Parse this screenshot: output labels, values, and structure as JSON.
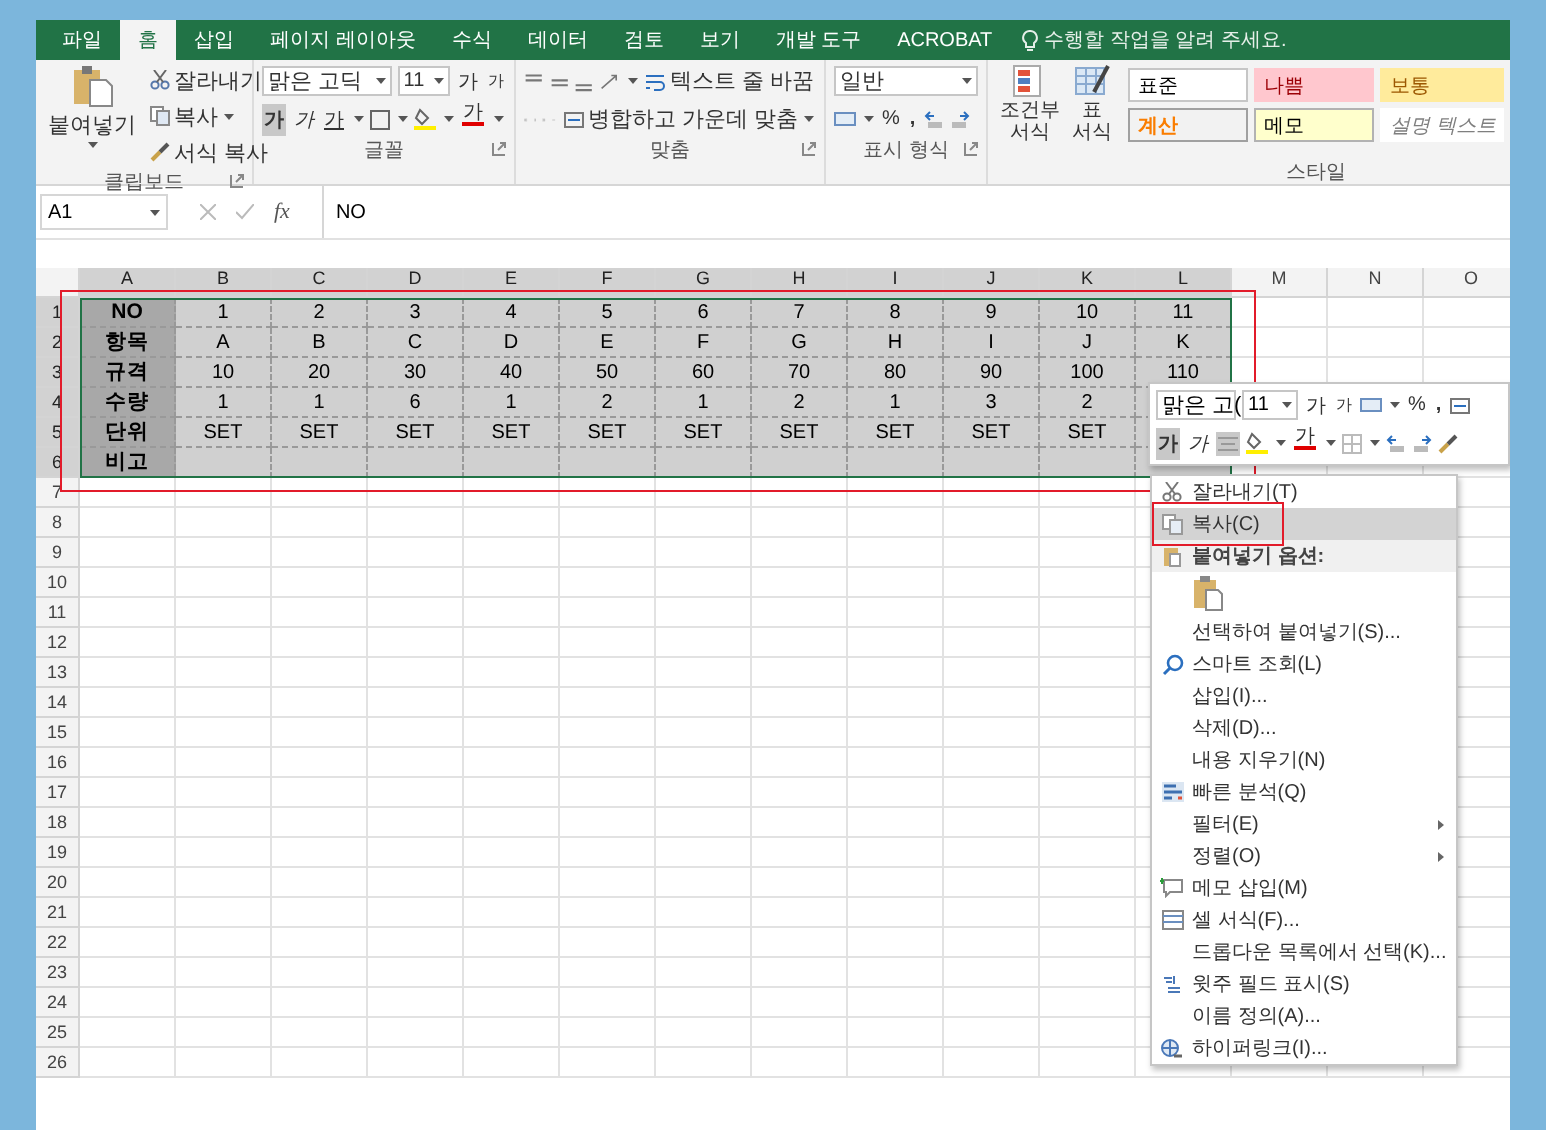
{
  "tabs": [
    {
      "label": "파일",
      "selected": false
    },
    {
      "label": "홈",
      "selected": true
    },
    {
      "label": "삽입",
      "selected": false
    },
    {
      "label": "페이지 레이아웃",
      "selected": false
    },
    {
      "label": "수식",
      "selected": false
    },
    {
      "label": "데이터",
      "selected": false
    },
    {
      "label": "검토",
      "selected": false
    },
    {
      "label": "보기",
      "selected": false
    },
    {
      "label": "개발 도구",
      "selected": false
    },
    {
      "label": "ACROBAT",
      "selected": false
    }
  ],
  "tell_me": "수행할 작업을 알려 주세요.",
  "ribbon": {
    "clipboard": {
      "paste": "붙여넣기",
      "cut": "잘라내기",
      "copy": "복사",
      "format_painter": "서식 복사",
      "label": "클립보드"
    },
    "font": {
      "name": "맑은 고딕",
      "size": "11",
      "grow": "가",
      "shrink": "가",
      "bold": "가",
      "italic": "가",
      "underline": "가",
      "font_color": "가",
      "label": "글꼴"
    },
    "alignment": {
      "wrap": "텍스트 줄 바꿈",
      "merge": "병합하고 가운데 맞춤",
      "label": "맞춤"
    },
    "number": {
      "format": "일반",
      "percent": "%",
      "comma": ",",
      "label": "표시 형식"
    },
    "conditional": [
      "조건부",
      "서식"
    ],
    "table_format": [
      "표",
      "서식"
    ],
    "styles": {
      "cells": [
        {
          "label": "표준",
          "kind": "normal"
        },
        {
          "label": "나쁨",
          "kind": "bad"
        },
        {
          "label": "보통",
          "kind": "neutral"
        },
        {
          "label": "계산",
          "kind": "calc"
        },
        {
          "label": "메모",
          "kind": "note"
        },
        {
          "label": "설명 텍스트",
          "kind": "explanatory"
        }
      ],
      "label": "스타일"
    }
  },
  "formula_bar": {
    "name_box": "A1",
    "fx": "fx",
    "value": "NO"
  },
  "grid": {
    "columns": [
      {
        "label": "A",
        "selected": true
      },
      {
        "label": "B",
        "selected": true
      },
      {
        "label": "C",
        "selected": true
      },
      {
        "label": "D",
        "selected": true
      },
      {
        "label": "E",
        "selected": true
      },
      {
        "label": "F",
        "selected": true
      },
      {
        "label": "G",
        "selected": true
      },
      {
        "label": "H",
        "selected": true
      },
      {
        "label": "I",
        "selected": true
      },
      {
        "label": "J",
        "selected": true
      },
      {
        "label": "K",
        "selected": true
      },
      {
        "label": "L",
        "selected": true
      },
      {
        "label": "M",
        "selected": false
      },
      {
        "label": "N",
        "selected": false
      },
      {
        "label": "O",
        "selected": false
      }
    ],
    "row_headers": [
      {
        "label": "1",
        "selected": true
      },
      {
        "label": "2",
        "selected": true
      },
      {
        "label": "3",
        "selected": true
      },
      {
        "label": "4",
        "selected": true
      },
      {
        "label": "5",
        "selected": true
      },
      {
        "label": "6",
        "selected": true
      },
      {
        "label": "7",
        "selected": false
      },
      {
        "label": "8",
        "selected": false
      },
      {
        "label": "9",
        "selected": false
      },
      {
        "label": "10",
        "selected": false
      },
      {
        "label": "11",
        "selected": false
      },
      {
        "label": "12",
        "selected": false
      },
      {
        "label": "13",
        "selected": false
      },
      {
        "label": "14",
        "selected": false
      },
      {
        "label": "15",
        "selected": false
      },
      {
        "label": "16",
        "selected": false
      },
      {
        "label": "17",
        "selected": false
      },
      {
        "label": "18",
        "selected": false
      },
      {
        "label": "19",
        "selected": false
      },
      {
        "label": "20",
        "selected": false
      },
      {
        "label": "21",
        "selected": false
      },
      {
        "label": "22",
        "selected": false
      },
      {
        "label": "23",
        "selected": false
      },
      {
        "label": "24",
        "selected": false
      },
      {
        "label": "25",
        "selected": false
      },
      {
        "label": "26",
        "selected": false
      }
    ],
    "data": [
      [
        "NO",
        "1",
        "2",
        "3",
        "4",
        "5",
        "6",
        "7",
        "8",
        "9",
        "10",
        "11"
      ],
      [
        "항목",
        "A",
        "B",
        "C",
        "D",
        "E",
        "F",
        "G",
        "H",
        "I",
        "J",
        "K"
      ],
      [
        "규격",
        "10",
        "20",
        "30",
        "40",
        "50",
        "60",
        "70",
        "80",
        "90",
        "100",
        "110"
      ],
      [
        "수량",
        "1",
        "1",
        "6",
        "1",
        "2",
        "1",
        "2",
        "1",
        "3",
        "2"
      ],
      [
        "단위",
        "SET",
        "SET",
        "SET",
        "SET",
        "SET",
        "SET",
        "SET",
        "SET",
        "SET",
        "SET"
      ],
      [
        "비고"
      ]
    ]
  },
  "mini_toolbar": {
    "font": "맑은 고(",
    "size": "11",
    "grow": "가",
    "shrink": "가",
    "percent": "%",
    "comma": ",",
    "bold": "가",
    "italic": "가",
    "font_color": "가"
  },
  "context_menu": {
    "items": [
      {
        "label": "잘라내기(T)",
        "kind": "cut",
        "selected": false
      },
      {
        "label": "복사(C)",
        "kind": "copy",
        "selected": true
      },
      {
        "label": "붙여넣기 옵션:",
        "kind": "header",
        "selected": false
      },
      {
        "kind": "paste-option",
        "selected": false
      },
      {
        "label": "선택하여 붙여넣기(S)...",
        "kind": "plain",
        "selected": false
      },
      {
        "label": "스마트 조회(L)",
        "kind": "search",
        "selected": false
      },
      {
        "label": "삽입(I)...",
        "kind": "plain",
        "selected": false
      },
      {
        "label": "삭제(D)...",
        "kind": "plain",
        "selected": false
      },
      {
        "label": "내용 지우기(N)",
        "kind": "plain",
        "selected": false
      },
      {
        "label": "빠른 분석(Q)",
        "kind": "analysis",
        "selected": false
      },
      {
        "label": "필터(E)",
        "kind": "submenu",
        "selected": false
      },
      {
        "label": "정렬(O)",
        "kind": "submenu",
        "selected": false
      },
      {
        "label": "메모 삽입(M)",
        "kind": "comment",
        "selected": false
      },
      {
        "label": "셀 서식(F)...",
        "kind": "format",
        "selected": false
      },
      {
        "label": "드롭다운 목록에서 선택(K)...",
        "kind": "plain",
        "selected": false
      },
      {
        "label": "윗주 필드 표시(S)",
        "kind": "phonetic",
        "selected": false
      },
      {
        "label": "이름 정의(A)...",
        "kind": "plain",
        "selected": false
      },
      {
        "label": "하이퍼링크(I)...",
        "kind": "link",
        "selected": false
      }
    ]
  }
}
